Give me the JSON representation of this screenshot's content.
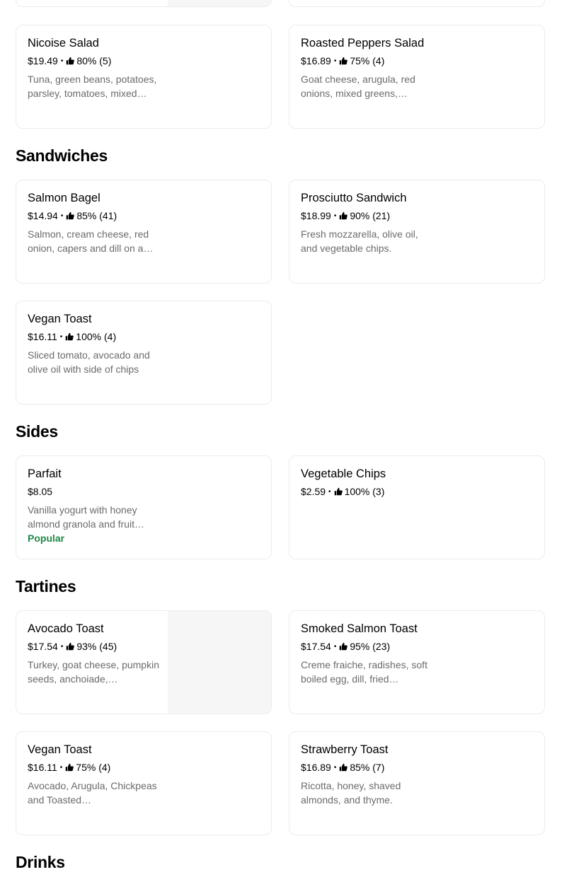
{
  "sections": [
    {
      "title": "Sandwiches"
    },
    {
      "title": "Sides"
    },
    {
      "title": "Tartines"
    },
    {
      "title": "Drinks"
    }
  ],
  "items": {
    "nicoise": {
      "name": "Nicoise Salad",
      "price": "$19.49",
      "rating": "80% (5)",
      "desc": "Tuna, green beans, potatoes, parsley, tomatoes, mixed…"
    },
    "roasted_peppers": {
      "name": "Roasted Peppers Salad",
      "price": "$16.89",
      "rating": "75% (4)",
      "desc": "Goat cheese, arugula, red onions, mixed greens,…"
    },
    "salmon_bagel": {
      "name": "Salmon Bagel",
      "price": "$14.94",
      "rating": "85% (41)",
      "desc": "Salmon, cream cheese, red onion, capers and dill on a…"
    },
    "prosciutto": {
      "name": "Prosciutto Sandwich",
      "price": "$18.99",
      "rating": "90% (21)",
      "desc": "Fresh mozzarella, olive oil, and vegetable chips."
    },
    "vegan_toast_1": {
      "name": "Vegan Toast",
      "price": "$16.11",
      "rating": "100% (4)",
      "desc": "Sliced tomato, avocado and olive oil with side of chips"
    },
    "parfait": {
      "name": "Parfait",
      "price": "$8.05",
      "desc": "Vanilla yogurt with honey almond granola and fruit…",
      "badge": "Popular"
    },
    "veg_chips": {
      "name": "Vegetable Chips",
      "price": "$2.59",
      "rating": "100% (3)"
    },
    "avocado_toast": {
      "name": "Avocado Toast",
      "price": "$17.54",
      "rating": "93% (45)",
      "desc": "Turkey, goat cheese, pumpkin seeds, anchoiade,…"
    },
    "smoked_salmon": {
      "name": "Smoked Salmon Toast",
      "price": "$17.54",
      "rating": "95% (23)",
      "desc": "Creme fraiche, radishes, soft boiled egg, dill, fried…"
    },
    "vegan_toast_2": {
      "name": "Vegan Toast",
      "price": "$16.11",
      "rating": "75% (4)",
      "desc": "Avocado, Arugula, Chickpeas and Toasted…"
    },
    "strawberry": {
      "name": "Strawberry Toast",
      "price": "$16.89",
      "rating": "85% (7)",
      "desc": "Ricotta, honey, shaved almonds, and thyme."
    }
  },
  "colors": {
    "popular": "#1e8a47",
    "description": "#6b6b6b",
    "image_placeholder": "#f6f6f6"
  },
  "icons": {
    "rating": "thumbs-up-icon"
  }
}
